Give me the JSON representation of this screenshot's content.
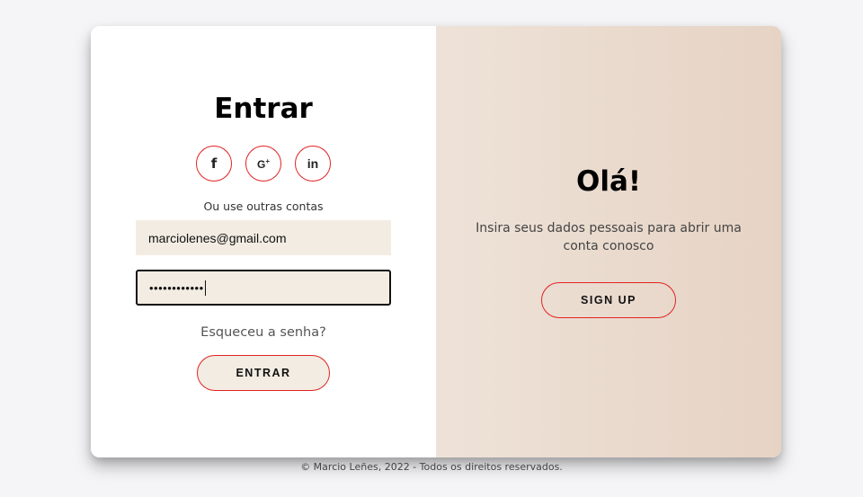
{
  "login": {
    "title": "Entrar",
    "socials": [
      {
        "label": "f",
        "icon": "facebook-icon"
      },
      {
        "label": "G",
        "sup": "+",
        "icon": "google-plus-icon"
      },
      {
        "label": "in",
        "icon": "linkedin-icon"
      }
    ],
    "subtext": "Ou use outras contas",
    "email_value": "marciolenes@gmail.com",
    "password_value": "••••••••••••",
    "forgot_label": "Esqueceu a senha?",
    "submit_label": "ENTRAR"
  },
  "panel": {
    "greeting": "Olá!",
    "info": "Insira seus dados pessoais para abrir uma conta conosco",
    "signup_label": "SIGN UP"
  },
  "footer": {
    "text": "© Marcio Leñes, 2022 - Todos os direitos reservados."
  },
  "colors": {
    "accent": "#e22222",
    "input_bg": "#f2ece2",
    "panel_gradient_start": "#eee2d8",
    "panel_gradient_end": "#e6d3c4"
  }
}
